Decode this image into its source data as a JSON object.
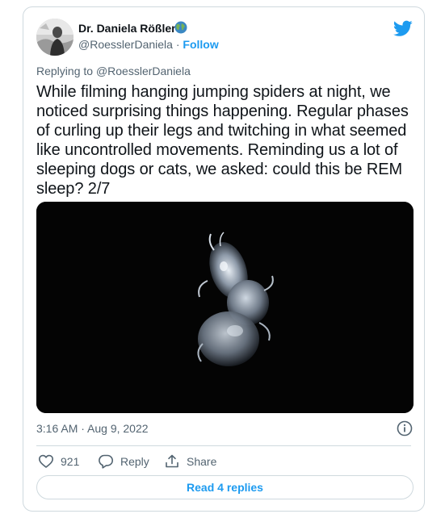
{
  "author": {
    "name": "Dr. Daniela Rößler",
    "handle": "@RoesslerDaniela",
    "separator": " · ",
    "follow_label": "Follow"
  },
  "reply_context": {
    "prefix": "Replying to ",
    "mention": "@RoesslerDaniela"
  },
  "tweet": {
    "text": "While filming hanging jumping spiders at night, we noticed surprising things happening. Regular phases of curling up their legs and twitching in what seemed like uncontrolled movements. Reminding us a lot of sleeping dogs or cats, we asked: could this be REM sleep? 2/7",
    "timestamp": "3:16 AM · Aug 9, 2022"
  },
  "actions": {
    "like_count": "921",
    "reply_label": "Reply",
    "share_label": "Share"
  },
  "read_replies_label": "Read 4 replies",
  "icons": {
    "globe": "globe-icon",
    "brand": "twitter-bird-icon",
    "info": "info-icon",
    "like": "heart-icon",
    "reply": "speech-bubble-icon",
    "share": "share-upload-icon"
  },
  "colors": {
    "accent": "#1d9bf0",
    "text_primary": "#0f1419",
    "text_secondary": "#536471",
    "border": "#cfd9de"
  }
}
